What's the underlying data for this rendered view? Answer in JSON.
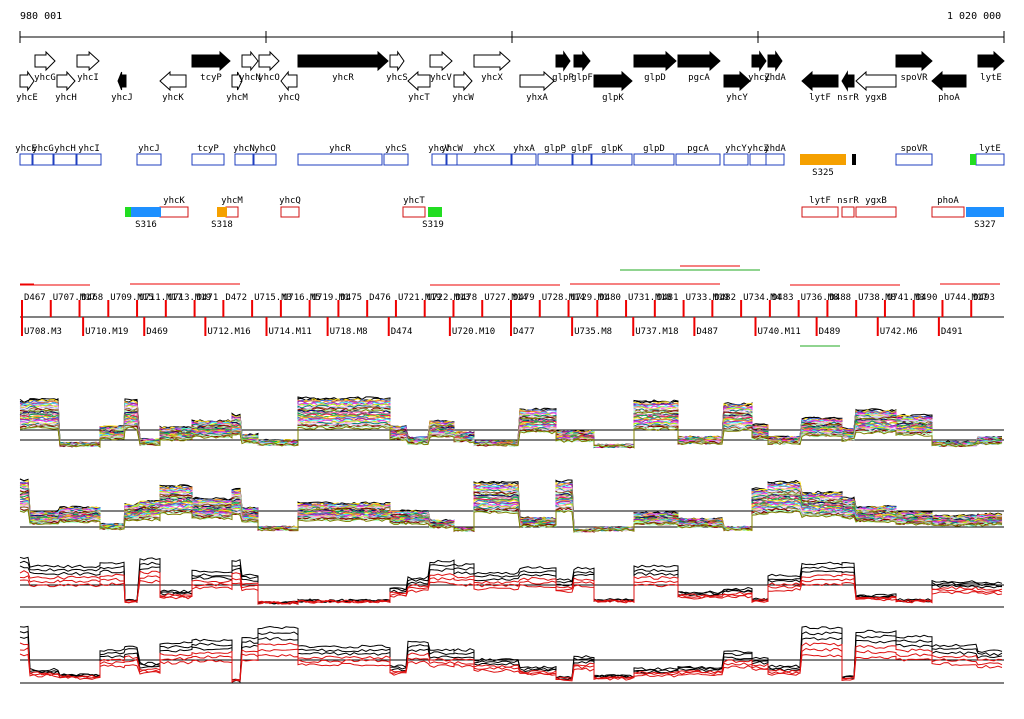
{
  "ruler": {
    "start_label": "980 001",
    "end_label": "1 020 000"
  },
  "colors": {
    "gene_fill": "#000000",
    "gene_outline": "#000000",
    "box_blue": "#1f3fbf",
    "box_red": "#d01010",
    "segment_blue": "#1e90ff",
    "segment_orange": "#f5a000",
    "segment_green": "#22dd22",
    "marker_red": "#ee0000",
    "profile_black": "#000000",
    "profile_red": "#dd1111",
    "profile_green": "#22aa22"
  },
  "genes": [
    {
      "name": "yhcE",
      "strand": "+",
      "filled": false,
      "label_row": "below"
    },
    {
      "name": "yhcG",
      "strand": "+",
      "filled": false,
      "label_row": "above"
    },
    {
      "name": "yhcH",
      "strand": "+",
      "filled": false,
      "label_row": "below"
    },
    {
      "name": "yhcI",
      "strand": "+",
      "filled": false,
      "label_row": "above"
    },
    {
      "name": "yhcJ",
      "strand": "-",
      "filled": true,
      "label_row": "below"
    },
    {
      "name": "yhcK",
      "strand": "-",
      "filled": false,
      "label_row": "below"
    },
    {
      "name": "tcyP",
      "strand": "+",
      "filled": true,
      "label_row": "above"
    },
    {
      "name": "yhcM",
      "strand": "+",
      "filled": false,
      "label_row": "below"
    },
    {
      "name": "yhcN",
      "strand": "+",
      "filled": false,
      "label_row": "above"
    },
    {
      "name": "yhcO",
      "strand": "+",
      "filled": false,
      "label_row": "above"
    },
    {
      "name": "yhcQ",
      "strand": "-",
      "filled": false,
      "label_row": "below"
    },
    {
      "name": "yhcR",
      "strand": "+",
      "filled": true,
      "label_row": "above"
    },
    {
      "name": "yhcS",
      "strand": "+",
      "filled": false,
      "label_row": "above"
    },
    {
      "name": "yhcT",
      "strand": "-",
      "filled": false,
      "label_row": "below"
    },
    {
      "name": "yhcV",
      "strand": "+",
      "filled": false,
      "label_row": "above"
    },
    {
      "name": "yhcW",
      "strand": "+",
      "filled": false,
      "label_row": "below"
    },
    {
      "name": "yhcX",
      "strand": "+",
      "filled": false,
      "label_row": "above"
    },
    {
      "name": "yhxA",
      "strand": "+",
      "filled": false,
      "label_row": "below"
    },
    {
      "name": "glpP",
      "strand": "+",
      "filled": true,
      "label_row": "above"
    },
    {
      "name": "glpF",
      "strand": "+",
      "filled": true,
      "label_row": "above"
    },
    {
      "name": "glpK",
      "strand": "+",
      "filled": true,
      "label_row": "below"
    },
    {
      "name": "glpD",
      "strand": "+",
      "filled": true,
      "label_row": "above"
    },
    {
      "name": "pgcA",
      "strand": "+",
      "filled": true,
      "label_row": "above"
    },
    {
      "name": "yhcY",
      "strand": "+",
      "filled": true,
      "label_row": "below"
    },
    {
      "name": "yhcZ",
      "strand": "+",
      "filled": true,
      "label_row": "above"
    },
    {
      "name": "yhdA",
      "strand": "+",
      "filled": true,
      "label_row": "above"
    },
    {
      "name": "lytF",
      "strand": "-",
      "filled": true,
      "label_row": "below"
    },
    {
      "name": "nsrR",
      "strand": "-",
      "filled": true,
      "label_row": "below"
    },
    {
      "name": "ygxB",
      "strand": "-",
      "filled": false,
      "label_row": "below"
    },
    {
      "name": "spoVR",
      "strand": "+",
      "filled": true,
      "label_row": "above"
    },
    {
      "name": "phoA",
      "strand": "-",
      "filled": true,
      "label_row": "below"
    },
    {
      "name": "lytE",
      "strand": "+",
      "filled": true,
      "label_row": "above"
    }
  ],
  "upper_boxes": [
    "yhcE",
    "yhcG",
    "yhcH",
    "yhcI",
    "yhcJ",
    "tcyP",
    "yhcN",
    "yhcO",
    "yhcR",
    "yhcS",
    "yhcV",
    "yhcW",
    "yhcX",
    "yhxA",
    "glpP",
    "glpF",
    "glpK",
    "glpD",
    "pgcA",
    "yhcY",
    "yhcZ",
    "yhdA",
    "spoVR",
    "lytE"
  ],
  "upper_segments": [
    {
      "label": "S325",
      "color": "orange"
    }
  ],
  "lower_boxes": [
    "yhcK",
    "yhcM",
    "yhcQ",
    "yhcT",
    "lytF",
    "nsrR",
    "ygxB",
    "phoA"
  ],
  "lower_segments": [
    {
      "label": "S316",
      "color": "blue"
    },
    {
      "label": "S318",
      "color": "orange"
    },
    {
      "label": "S319",
      "color": "green"
    },
    {
      "label": "S327",
      "color": "blue"
    }
  ],
  "upstream_markers_top": [
    "D467",
    "U707.M17",
    "D468",
    "U709.M15",
    "U711.M17",
    "U713.M19",
    "D471",
    "D472",
    "U715.M3",
    "U716.M5",
    "U719.M1",
    "D475",
    "D476",
    "U721.M19",
    "U722.M13",
    "D478",
    "U727.M14",
    "D479",
    "U728.M14",
    "U729.M1",
    "D480",
    "U731.M18",
    "D481",
    "U733.M19",
    "D482",
    "U734.M4",
    "D483",
    "U736.M8",
    "D488",
    "U738.M8",
    "U741.M3",
    "D490",
    "U744.M17",
    "D493"
  ],
  "upstream_markers_bottom": [
    "U708.M3",
    "U710.M19",
    "D469",
    "U712.M16",
    "U714.M11",
    "U718.M8",
    "D474",
    "U720.M10",
    "D477",
    "U735.M8",
    "U737.M18",
    "D487",
    "U740.M11",
    "D489",
    "U742.M6",
    "D491"
  ],
  "profiles": [
    {
      "panel": "expression-1",
      "style": "multicolor"
    },
    {
      "panel": "expression-2",
      "style": "multicolor"
    },
    {
      "panel": "expression-3",
      "style": "black-red"
    },
    {
      "panel": "expression-4",
      "style": "black-red"
    }
  ]
}
